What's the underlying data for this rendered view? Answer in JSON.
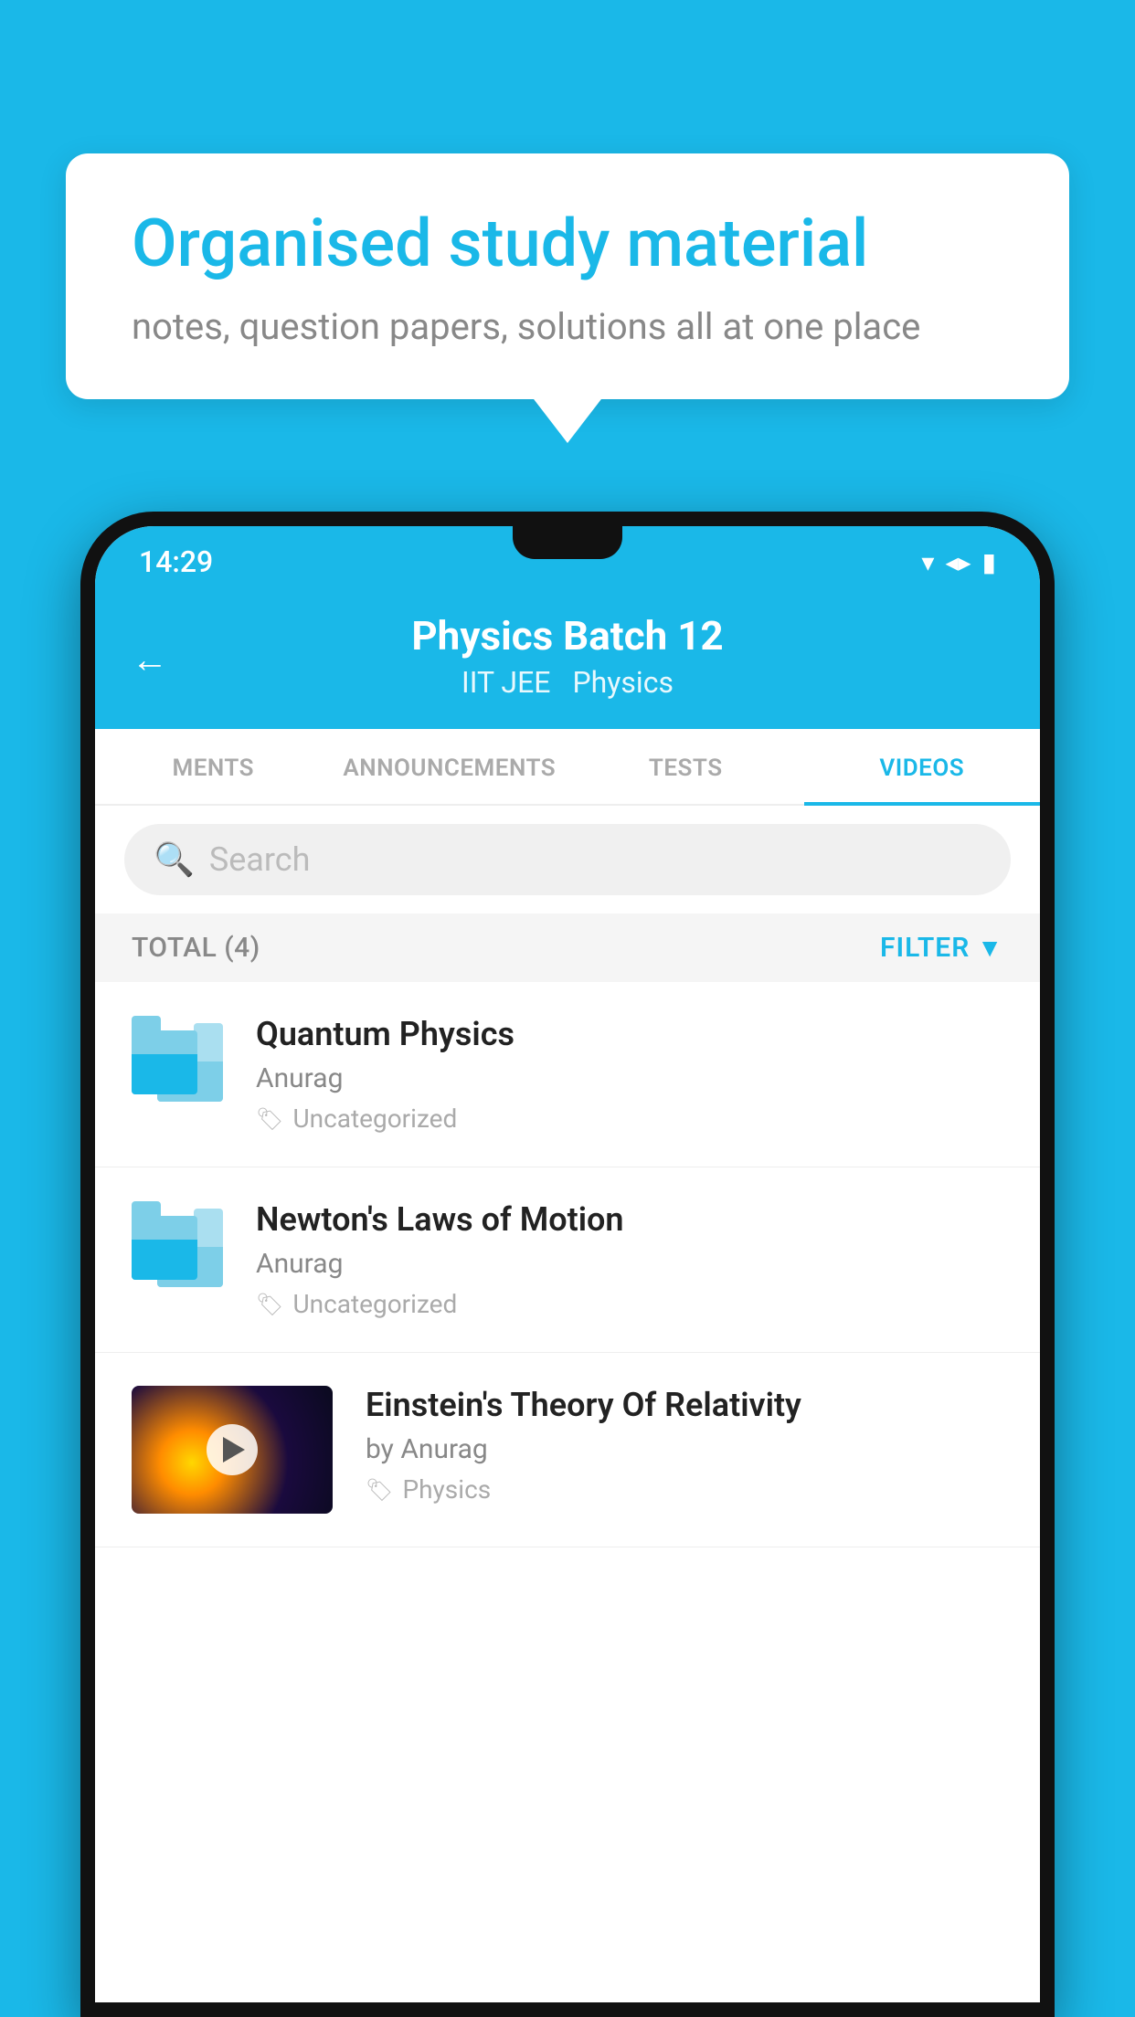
{
  "background": {
    "color": "#1ab8e8"
  },
  "speech_bubble": {
    "title": "Organised study material",
    "subtitle": "notes, question papers, solutions all at one place"
  },
  "phone": {
    "status_bar": {
      "time": "14:29"
    },
    "header": {
      "title": "Physics Batch 12",
      "subtitle1": "IIT JEE",
      "subtitle2": "Physics",
      "back_label": "←"
    },
    "tabs": [
      {
        "label": "MENTS",
        "active": false
      },
      {
        "label": "ANNOUNCEMENTS",
        "active": false
      },
      {
        "label": "TESTS",
        "active": false
      },
      {
        "label": "VIDEOS",
        "active": true
      }
    ],
    "search": {
      "placeholder": "Search"
    },
    "filter_bar": {
      "total": "TOTAL (4)",
      "filter_label": "FILTER"
    },
    "videos": [
      {
        "title": "Quantum Physics",
        "author": "Anurag",
        "tag": "Uncategorized",
        "has_thumb": false
      },
      {
        "title": "Newton's Laws of Motion",
        "author": "Anurag",
        "tag": "Uncategorized",
        "has_thumb": false
      },
      {
        "title": "Einstein's Theory Of Relativity",
        "author": "by Anurag",
        "tag": "Physics",
        "has_thumb": true
      }
    ]
  }
}
